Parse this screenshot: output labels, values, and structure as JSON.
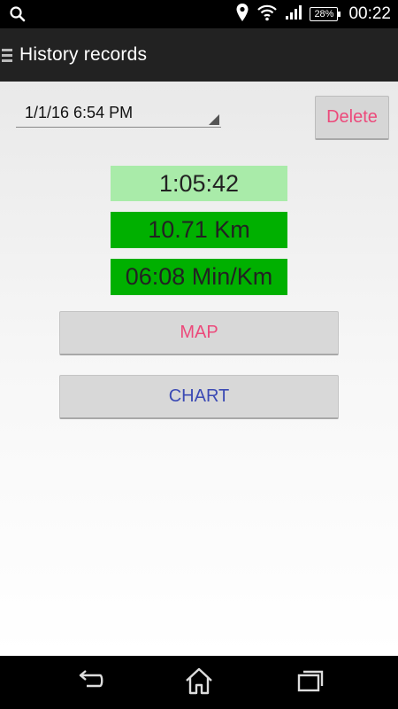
{
  "status_bar": {
    "battery": "28%",
    "time": "00:22",
    "icons": [
      "search-icon",
      "location-icon",
      "wifi-icon",
      "signal-icon",
      "battery-icon"
    ]
  },
  "action_bar": {
    "title": "History records",
    "icon": "menu-icon"
  },
  "record": {
    "selected_date": "1/1/16 6:54 PM",
    "delete_label": "Delete",
    "duration": "1:05:42",
    "distance": "10.71 Km",
    "pace": "06:08 Min/Km"
  },
  "buttons": {
    "map_label": "MAP",
    "chart_label": "CHART"
  },
  "colors": {
    "accent_pink": "#ec4a7b",
    "accent_blue": "#3b4ab4",
    "duration_bg": "#a9eba9",
    "stat_green": "#00b000"
  },
  "nav_bar": {
    "icons": [
      "back-icon",
      "home-icon",
      "recents-icon"
    ]
  }
}
